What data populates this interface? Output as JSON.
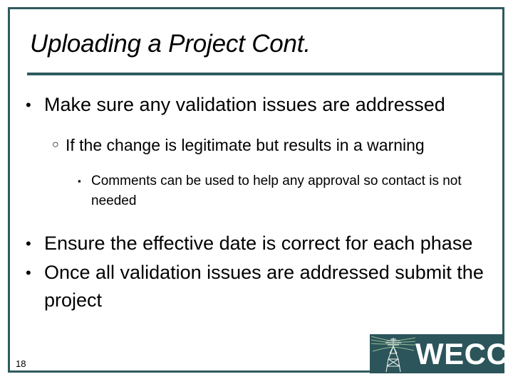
{
  "slide": {
    "title": "Uploading a Project Cont.",
    "page_number": "18",
    "accent_color": "#2e5b5e",
    "logo_background": "#2b555a",
    "power_line_color": "#9ec298",
    "text_color": "#000000",
    "background_color": "#ffffff"
  },
  "bullets": [
    {
      "level": 1,
      "marker": "bullet-dot",
      "marker_glyph": "•",
      "text": "Make sure any validation issues are addressed"
    },
    {
      "level": 2,
      "marker": "bullet-hollow-circle",
      "marker_glyph": "○",
      "text": "If the change is legitimate but results in a warning"
    },
    {
      "level": 3,
      "marker": "bullet-small-square",
      "marker_glyph": "▪",
      "text": "Comments can be used to help any approval so contact is not needed"
    },
    {
      "level": 1,
      "marker": "bullet-dot",
      "marker_glyph": "•",
      "text": "Ensure the effective date is correct for each phase"
    },
    {
      "level": 1,
      "marker": "bullet-dot",
      "marker_glyph": "•",
      "text": "Once all validation issues are addressed submit the project"
    }
  ],
  "logo": {
    "name": "wecc-logo",
    "text": "WECC",
    "icon": "transmission-tower-icon"
  }
}
